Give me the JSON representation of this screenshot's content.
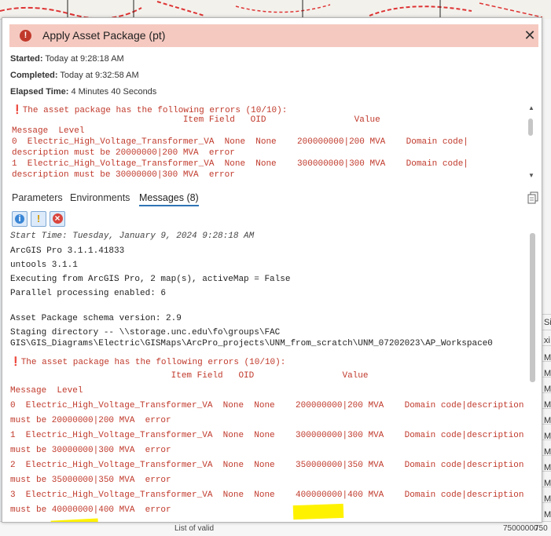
{
  "dialog": {
    "title": "Apply Asset Package (pt)",
    "started_label": "Started:",
    "started_value": "Today at 9:28:18 AM",
    "completed_label": "Completed:",
    "completed_value": "Today at 9:32:58 AM",
    "elapsed_label": "Elapsed Time:",
    "elapsed_value": "4 Minutes 40 Seconds"
  },
  "error_box": {
    "heading": "The asset package has the following errors (10/10):",
    "header1": "                                 Item Field   OID                 Value",
    "header2": "Message  Level",
    "rows": [
      "0  Electric_High_Voltage_Transformer_VA  None  None    200000000|200 MVA    Domain code|",
      "description must be 20000000|200 MVA  error",
      "1  Electric_High_Voltage_Transformer_VA  None  None    300000000|300 MVA    Domain code|",
      "description must be 30000000|300 MVA  error"
    ]
  },
  "tabs": [
    {
      "label": "Parameters"
    },
    {
      "label": "Environments"
    },
    {
      "label": "Messages (8)"
    }
  ],
  "filters": {
    "info": "i",
    "warning": "!",
    "error": "×"
  },
  "messages": {
    "start_time": "Start Time: Tuesday, January 9, 2024 9:28:18 AM",
    "lines": [
      "ArcGIS Pro 3.1.1.41833",
      "untools 3.1.1",
      "Executing from ArcGIS Pro, 2 map(s), activeMap = False",
      "Parallel processing enabled: 6",
      "",
      "Asset Package schema version: 2.9",
      "Staging directory -- \\\\storage.unc.edu\\fo\\groups\\FAC",
      "GIS\\GIS_Diagrams\\Electric\\GISMaps\\ArcPro_projects\\UNM_from_scratch\\UNM_07202023\\AP_Workspace0"
    ],
    "error_heading": "The asset package has the following errors (10/10):",
    "error_header1": "                               Item Field   OID                 Value",
    "error_header2": "Message  Level",
    "error_rows": [
      "0  Electric_High_Voltage_Transformer_VA  None  None    200000000|200 MVA    Domain code|description",
      "must be 20000000|200 MVA  error",
      "1  Electric_High_Voltage_Transformer_VA  None  None    300000000|300 MVA    Domain code|description",
      "must be 30000000|300 MVA  error",
      "2  Electric_High_Voltage_Transformer_VA  None  None    350000000|350 MVA    Domain code|description",
      "must be 35000000|350 MVA  error",
      "3  Electric_High_Voltage_Transformer_VA  None  None    400000000|400 MVA    Domain code|description",
      "must be 40000000|400 MVA  error"
    ]
  },
  "background": {
    "right_labels": [
      "Si",
      "xi",
      "M",
      "M",
      "M",
      "M",
      "M",
      "M",
      "M",
      "M",
      "M",
      "M",
      "M"
    ],
    "bottom_left": "List of valid",
    "bottom_right": "75000000",
    "bottom_right2": "750"
  },
  "colors": {
    "title_bg": "#f5c9c0",
    "error_text": "#c0392b",
    "highlight": "#fff200",
    "tab_underline": "#2f74b5"
  }
}
